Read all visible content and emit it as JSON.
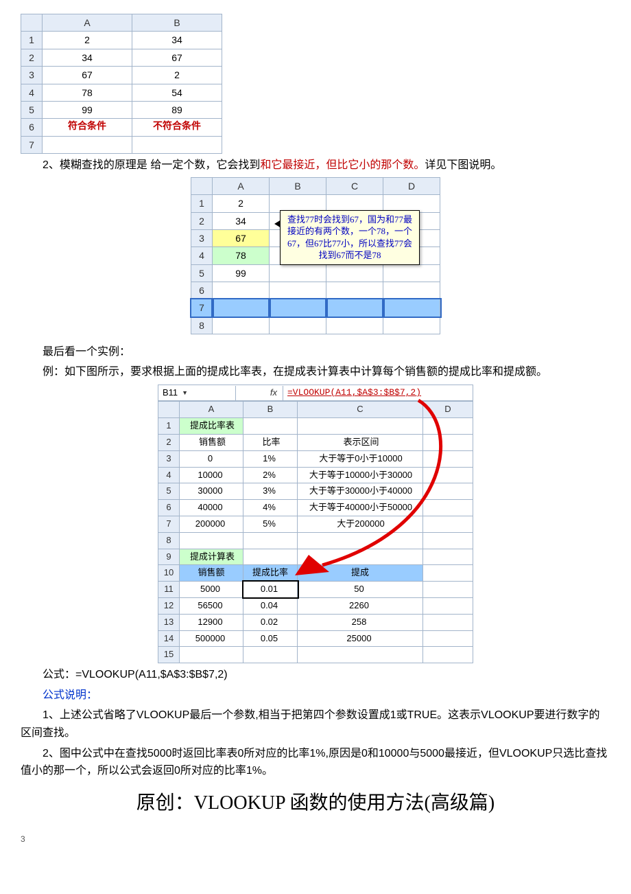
{
  "table1": {
    "headers": [
      "A",
      "B"
    ],
    "rows": [
      {
        "n": "1",
        "a": "2",
        "b": "34"
      },
      {
        "n": "2",
        "a": "34",
        "b": "67"
      },
      {
        "n": "3",
        "a": "67",
        "b": "2"
      },
      {
        "n": "4",
        "a": "78",
        "b": "54"
      },
      {
        "n": "5",
        "a": "99",
        "b": "89"
      },
      {
        "n": "6",
        "a": "符合条件",
        "b": "不符合条件"
      },
      {
        "n": "7",
        "a": "",
        "b": ""
      }
    ]
  },
  "para1": {
    "prefix": "2、模糊查找的原理是 给一定个数，它会找到",
    "red": "和它最接近，但比它小的那个数。",
    "suffix": "详见下图说明。"
  },
  "table2": {
    "headers": [
      "A",
      "B",
      "C",
      "D"
    ],
    "rows": [
      "1",
      "2",
      "3",
      "4",
      "5",
      "6",
      "7",
      "8"
    ],
    "colA": {
      "1": "2",
      "2": "34",
      "3": "67",
      "4": "78",
      "5": "99"
    },
    "callout": "查找77时会找到67，国为和77最接近的有两个数，一个78，一个67，但67比77小，所以查找77会找到67而不是78"
  },
  "para2": "最后看一个实例：",
  "para3": "例：如下图所示，要求根据上面的提成比率表，在提成表计算表中计算每个销售额的提成比率和提成额。",
  "formula_bar": {
    "name": "B11",
    "fx": "fx",
    "formula": "=VLOOKUP(A11,$A$3:$B$7,2)"
  },
  "table3": {
    "headers": [
      "A",
      "B",
      "C",
      "D"
    ],
    "title1": "提成比率表",
    "hdr2": {
      "a": "销售额",
      "b": "比率",
      "c": "表示区间"
    },
    "rates": [
      {
        "n": "3",
        "sales": "0",
        "rate": "1%",
        "range": "大于等于0小于10000"
      },
      {
        "n": "4",
        "sales": "10000",
        "rate": "2%",
        "range": "大于等于10000小于30000"
      },
      {
        "n": "5",
        "sales": "30000",
        "rate": "3%",
        "range": "大于等于30000小于40000"
      },
      {
        "n": "6",
        "sales": "40000",
        "rate": "4%",
        "range": "大于等于40000小于50000"
      },
      {
        "n": "7",
        "sales": "200000",
        "rate": "5%",
        "range": "大于200000"
      }
    ],
    "title2": "提成计算表",
    "hdr10": {
      "a": "销售额",
      "b": "提成比率",
      "c": "提成"
    },
    "calc": [
      {
        "n": "11",
        "sales": "5000",
        "rate": "0.01",
        "comm": "50"
      },
      {
        "n": "12",
        "sales": "56500",
        "rate": "0.04",
        "comm": "2260"
      },
      {
        "n": "13",
        "sales": "12900",
        "rate": "0.02",
        "comm": "258"
      },
      {
        "n": "14",
        "sales": "500000",
        "rate": "0.05",
        "comm": "25000"
      }
    ]
  },
  "para4": "公式：=VLOOKUP(A11,$A$3:$B$7,2)",
  "para5": "公式说明：",
  "para6": "1、上述公式省略了VLOOKUP最后一个参数,相当于把第四个参数设置成1或TRUE。这表示VLOOKUP要进行数字的区间查找。",
  "para7": "2、图中公式中在查找5000时返回比率表0所对应的比率1%,原因是0和10000与5000最接近，但VLOOKUP只选比查找值小的那一个，所以公式会返回0所对应的比率1%。",
  "heading": "原创：VLOOKUP 函数的使用方法(高级篇)",
  "page": "3"
}
